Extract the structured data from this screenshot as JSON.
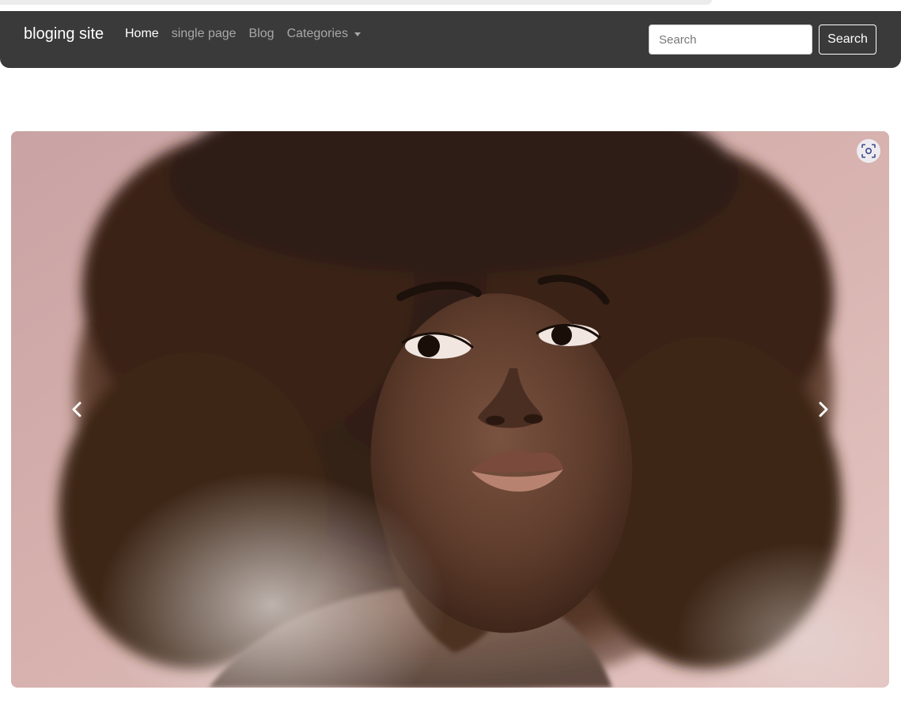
{
  "navbar": {
    "brand": "bloging site",
    "links": [
      {
        "label": "Home",
        "active": true
      },
      {
        "label": "single page",
        "active": false
      },
      {
        "label": "Blog",
        "active": false
      },
      {
        "label": "Categories",
        "active": false,
        "dropdown": true
      }
    ],
    "search": {
      "placeholder": "Search",
      "value": "",
      "button_label": "Search"
    }
  },
  "carousel": {
    "controls": {
      "prev_icon": "chevron-left-icon",
      "next_icon": "chevron-right-icon"
    },
    "visual_search_icon": "image-search-icon"
  },
  "colors": {
    "navbar_bg": "#3a3a3a",
    "nav_active": "#ffffff",
    "nav_inactive": "#a8a8a8",
    "photo_background": "#d8b0ae"
  }
}
